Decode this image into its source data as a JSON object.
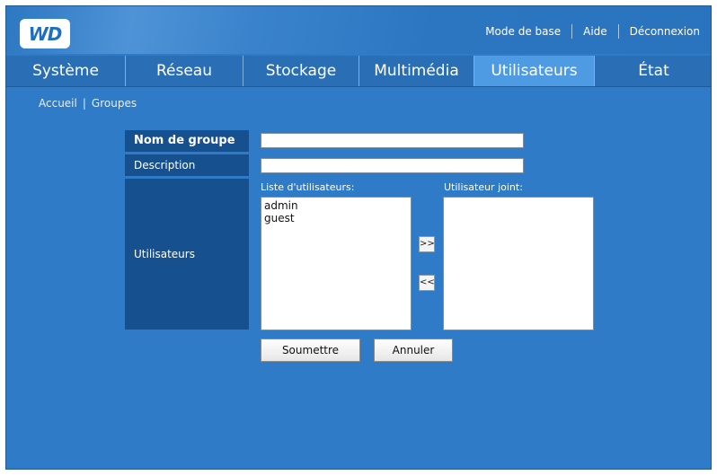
{
  "header": {
    "logo_text": "WD",
    "links": {
      "basic_mode": "Mode de base",
      "help": "Aide",
      "logout": "Déconnexion"
    }
  },
  "nav": {
    "tabs": [
      {
        "label": "Système",
        "active": false
      },
      {
        "label": "Réseau",
        "active": false
      },
      {
        "label": "Stockage",
        "active": false
      },
      {
        "label": "Multimédia",
        "active": false
      },
      {
        "label": "Utilisateurs",
        "active": true
      },
      {
        "label": "État",
        "active": false
      }
    ]
  },
  "breadcrumb": {
    "home": "Accueil",
    "separator": "|",
    "current": "Groupes"
  },
  "form": {
    "group_name_label": "Nom de groupe",
    "group_name_value": "",
    "description_label": "Description",
    "description_value": "",
    "users_label": "Utilisateurs",
    "user_list_caption": "Liste d'utilisateurs:",
    "user_list": [
      "admin",
      "guest"
    ],
    "joined_caption": "Utilisateur joint:",
    "joined_list": [],
    "add_button": ">>",
    "remove_button": "<<",
    "submit_button": "Soumettre",
    "cancel_button": "Annuler"
  },
  "colors": {
    "background": "#2f7bc7",
    "nav_active": "#4e9be3",
    "label_bg": "#17508f"
  }
}
